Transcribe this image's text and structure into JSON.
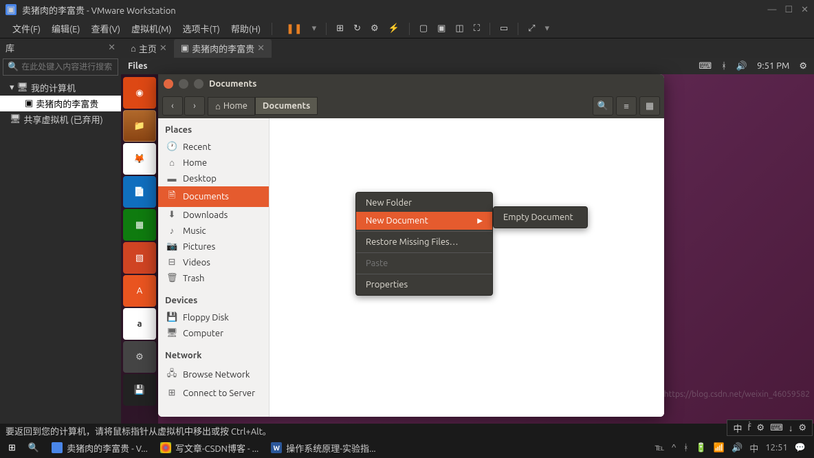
{
  "vmware": {
    "title": "卖猪肉的李富贵 - VMware Workstation",
    "menu": [
      "文件(F)",
      "编辑(E)",
      "查看(V)",
      "虚拟机(M)",
      "选项卡(T)",
      "帮助(H)"
    ],
    "library_label": "库",
    "search_placeholder": "在此处键入内容进行搜索",
    "tree": {
      "root": "我的计算机",
      "vm": "卖猪肉的李富贵",
      "shared": "共享虚拟机 (已弃用)"
    },
    "tabs": {
      "home": "主页",
      "vm": "卖猪肉的李富贵"
    },
    "status": "要返回到您的计算机，请将鼠标指针从虚拟机中移出或按 Ctrl+Alt。"
  },
  "ubuntu": {
    "menubar_app": "Files",
    "time": "9:51 PM",
    "nautilus": {
      "title": "Documents",
      "path": {
        "home": "Home",
        "current": "Documents"
      },
      "sidebar": {
        "places_header": "Places",
        "places": [
          "Recent",
          "Home",
          "Desktop",
          "Documents",
          "Downloads",
          "Music",
          "Pictures",
          "Videos",
          "Trash"
        ],
        "devices_header": "Devices",
        "devices": [
          "Floppy Disk",
          "Computer"
        ],
        "network_header": "Network",
        "network": [
          "Browse Network",
          "Connect to Server"
        ]
      },
      "context_menu": {
        "items": [
          "New Folder",
          "New Document",
          "Restore Missing Files…",
          "Paste",
          "Properties"
        ],
        "submenu": [
          "Empty Document"
        ]
      }
    }
  },
  "taskbar": {
    "items": [
      "卖猪肉的李富贵 - V...",
      "写文章-CSDN博客 - ...",
      "操作系统原理-实验指..."
    ],
    "cn_ime": "中",
    "time": "12:51"
  },
  "watermark": "https://blog.csdn.net/weixin_46059582"
}
